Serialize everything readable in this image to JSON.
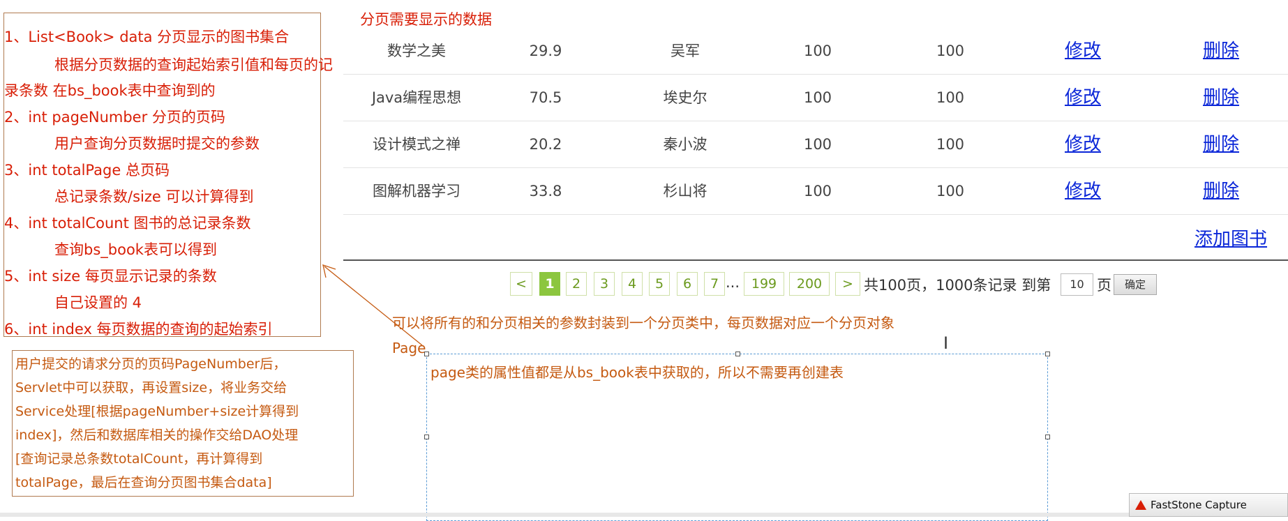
{
  "annotation_box_1": {
    "lines": [
      "1、List<Book> data 分页显示的图书集合",
      "根据分页数据的查询起始索引值和每页的记",
      "录条数 在bs_book表中查询到的",
      "2、int pageNumber  分页的页码",
      "用户查询分页数据时提交的参数",
      "3、int totalPage  总页码",
      "总记录条数/size 可以计算得到",
      "4、int totalCount   图书的总记录条数",
      "查询bs_book表可以得到",
      "5、int size  每页显示记录的条数",
      "自己设置的 4",
      "6、int index   每页数据的查询的起始索引"
    ]
  },
  "annotation_box_2": {
    "lines": [
      "用户提交的请求分页的页码PageNumber后，",
      "Servlet中可以获取，再设置size，将业务交给",
      "Service处理[根据pageNumber+size计算得到",
      "index]，然后和数据库相关的操作交给DAO处理",
      "[查询记录总条数totalCount，再计算得到",
      "totalPage，最后在查询分页图书集合data]"
    ]
  },
  "data_title": "分页需要显示的数据",
  "table": {
    "rows": [
      {
        "name": "数学之美",
        "price": "29.9",
        "author": "吴军",
        "sales": "100",
        "stock": "100",
        "edit": "修改",
        "delete": "删除"
      },
      {
        "name": "Java编程思想",
        "price": "70.5",
        "author": "埃史尔",
        "sales": "100",
        "stock": "100",
        "edit": "修改",
        "delete": "删除"
      },
      {
        "name": "设计模式之禅",
        "price": "20.2",
        "author": "秦小波",
        "sales": "100",
        "stock": "100",
        "edit": "修改",
        "delete": "删除"
      },
      {
        "name": "图解机器学习",
        "price": "33.8",
        "author": "杉山将",
        "sales": "100",
        "stock": "100",
        "edit": "修改",
        "delete": "删除"
      }
    ]
  },
  "add_book": "添加图书",
  "pagination": {
    "prev": "<",
    "pages": [
      "1",
      "2",
      "3",
      "4",
      "5",
      "6",
      "7"
    ],
    "ellipsis": "...",
    "last_pages": [
      "199",
      "200"
    ],
    "next": ">",
    "summary": "共100页，1000条记录 到第",
    "goto_value": "10",
    "page_suffix": "页",
    "confirm": "确定",
    "current_page": "1"
  },
  "description": "可以将所有的和分页相关的参数封装到一个分页类中，每页数据对应一个分页对象",
  "page_label": "Page",
  "selection_text": "page类的属性值都是从bs_book表中获取的，所以不需要再创建表",
  "taskbar": {
    "app": "FastStone Capture"
  },
  "colors": {
    "annotation_red": "#d81e06",
    "annotation_orange": "#c55a11",
    "link_blue": "#0a26d8",
    "pager_green": "#8cc63f"
  }
}
